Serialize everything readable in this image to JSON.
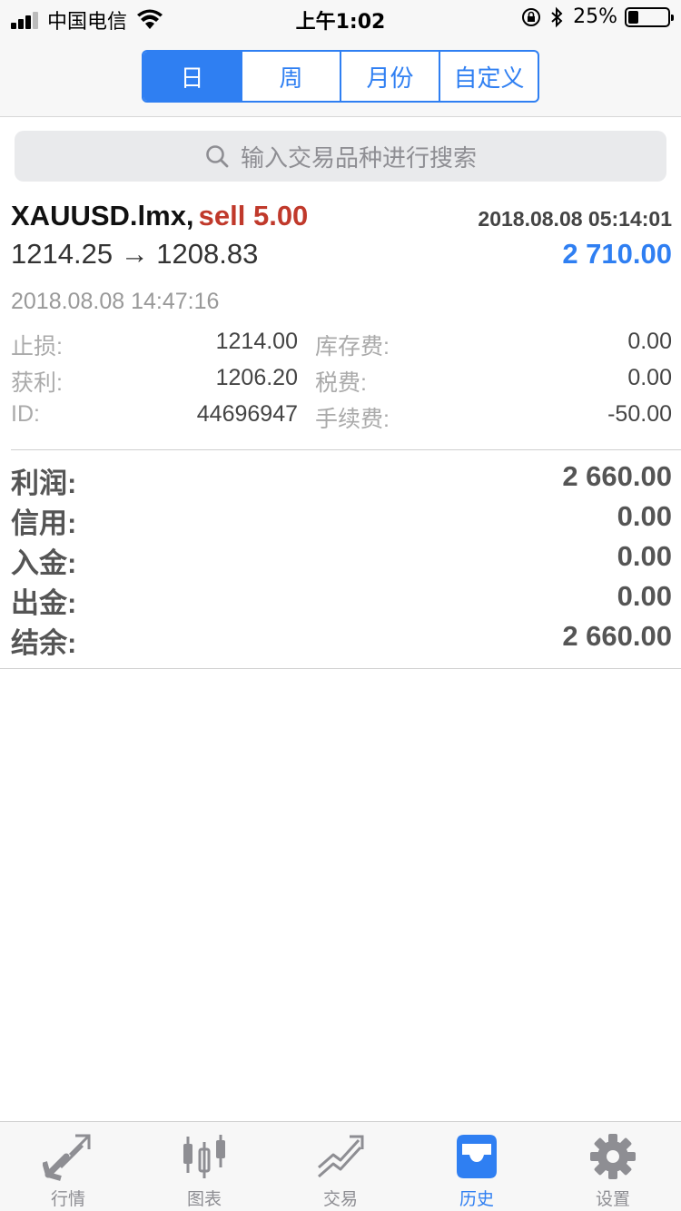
{
  "status_bar": {
    "carrier": "中国电信",
    "time": "上午1:02",
    "battery_percent": "25%",
    "battery_level": 0.25
  },
  "period_tabs": [
    {
      "label": "日",
      "active": true
    },
    {
      "label": "周",
      "active": false
    },
    {
      "label": "月份",
      "active": false
    },
    {
      "label": "自定义",
      "active": false
    }
  ],
  "search": {
    "placeholder": "输入交易品种进行搜索"
  },
  "trade": {
    "symbol": "XAUUSD.lmx,",
    "side": "sell 5.00",
    "open_time": "2018.08.08 05:14:01",
    "prices": "1214.25 → 1208.83",
    "profit": "2 710.00",
    "close_time": "2018.08.08 14:47:16",
    "details": [
      {
        "label": "止损:",
        "value": "1214.00",
        "label2": "库存费:",
        "value2": "0.00"
      },
      {
        "label": "获利:",
        "value": "1206.20",
        "label2": "税费:",
        "value2": "0.00"
      },
      {
        "label": "ID:",
        "value": "44696947",
        "label2": "手续费:",
        "value2": "-50.00"
      }
    ]
  },
  "summary": [
    {
      "label": "利润:",
      "value": "2 660.00"
    },
    {
      "label": "信用:",
      "value": "0.00"
    },
    {
      "label": "入金:",
      "value": "0.00"
    },
    {
      "label": "出金:",
      "value": "0.00"
    },
    {
      "label": "结余:",
      "value": "2 660.00"
    }
  ],
  "tabbar": [
    {
      "label": "行情",
      "icon": "quotes-arrows-icon",
      "active": false
    },
    {
      "label": "图表",
      "icon": "candlestick-chart-icon",
      "active": false
    },
    {
      "label": "交易",
      "icon": "trade-trend-icon",
      "active": false
    },
    {
      "label": "历史",
      "icon": "history-inbox-icon",
      "active": true
    },
    {
      "label": "设置",
      "icon": "gear-icon",
      "active": false
    }
  ],
  "colors": {
    "accent": "#2f7ff2",
    "sell": "#c0392b",
    "inactive": "#8e8e93"
  }
}
